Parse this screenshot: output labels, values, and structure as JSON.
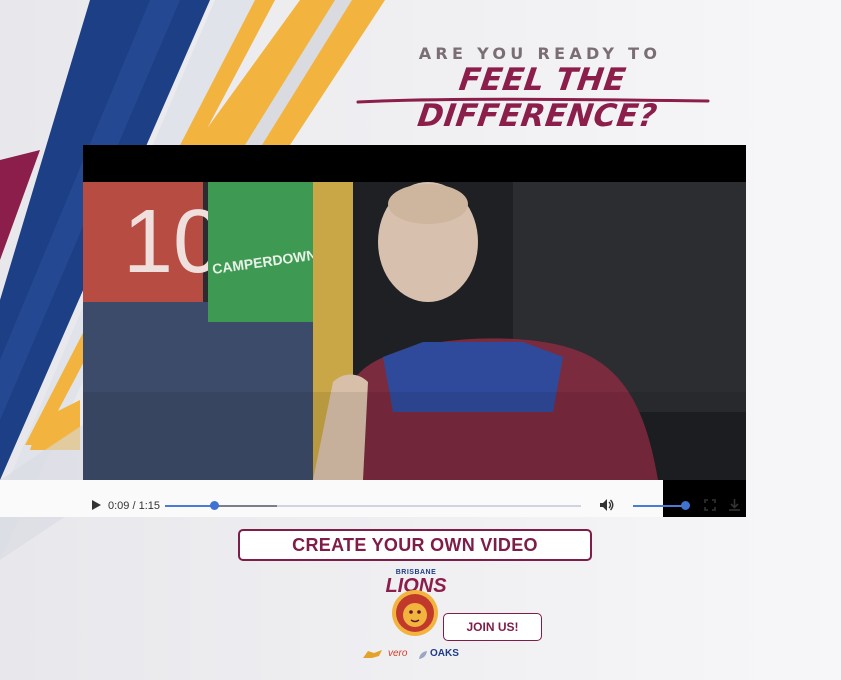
{
  "headline": {
    "small": "ARE YOU READY TO",
    "big": "FEEL THE DIFFERENCE?"
  },
  "video": {
    "current_time": "0:09",
    "separator": "/",
    "duration": "1:15",
    "progress": 0.12,
    "buffered": 0.27,
    "volume": 1.0,
    "scene_sign_number": "10",
    "scene_sign_brand": "CAMPERDOWN"
  },
  "cta": {
    "label": "CREATE YOUR OWN VIDEO"
  },
  "logo": {
    "city": "BRISBANE",
    "name": "LIONS"
  },
  "join": {
    "label": "JOIN US!"
  },
  "sponsors": {
    "vero": "vero",
    "oaks": "OAKS"
  },
  "colors": {
    "maroon": "#7e1d47",
    "navy": "#1f3c85",
    "gold": "#f2b43e",
    "progress_blue": "#4a7bd6"
  },
  "icons": [
    "play-icon",
    "volume-icon",
    "fullscreen-icon",
    "download-icon",
    "lion-logo-icon"
  ]
}
